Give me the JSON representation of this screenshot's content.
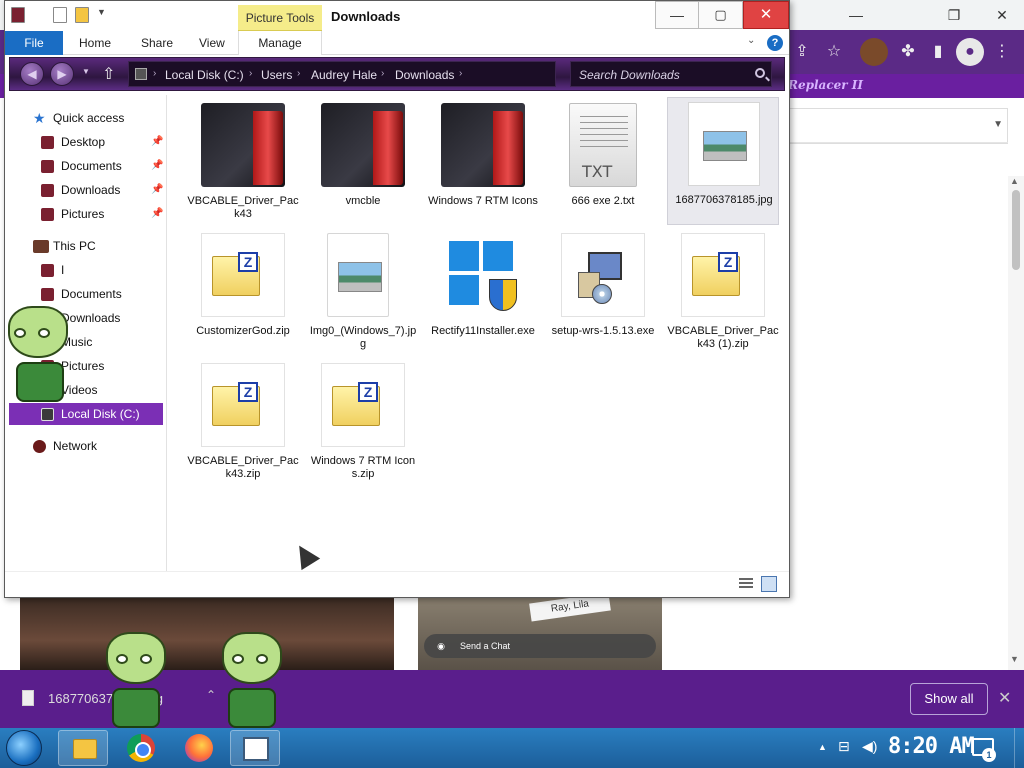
{
  "browser": {
    "extension_label": "Replacer II",
    "chat_placeholder": "Send a Chat",
    "photo_tag": "Ray, Lila"
  },
  "explorer": {
    "context_tab": "Picture Tools",
    "title": "Downloads",
    "ribbon_tabs": [
      "File",
      "Home",
      "Share",
      "View",
      "Manage"
    ],
    "breadcrumb": [
      "Local Disk (C:)",
      "Users",
      "Audrey Hale",
      "Downloads"
    ],
    "search_placeholder": "Search Downloads",
    "nav": {
      "quick_access": "Quick access",
      "desktop": "Desktop",
      "documents": "Documents",
      "downloads": "Downloads",
      "pictures": "Pictures",
      "this_pc": "This PC",
      "pc_item1": "I",
      "pc_documents": "Documents",
      "pc_downloads": "Downloads",
      "pc_music": "Music",
      "pc_pictures": "Pictures",
      "pc_videos": "Videos",
      "local_disk": "Local Disk (C:)",
      "network": "Network"
    },
    "files": [
      {
        "name": "VBCABLE_Driver_Pack43",
        "type": "folder"
      },
      {
        "name": "vmcble",
        "type": "folder"
      },
      {
        "name": "Windows 7 RTM Icons",
        "type": "folder"
      },
      {
        "name": "666 exe 2.txt",
        "type": "txt",
        "badge": "TXT"
      },
      {
        "name": "1687706378185.jpg",
        "type": "jpg",
        "selected": true
      },
      {
        "name": "CustomizerGod.zip",
        "type": "zip"
      },
      {
        "name": "Img0_(Windows_7).jpg",
        "type": "jpg"
      },
      {
        "name": "Rectify11Installer.exe",
        "type": "exe"
      },
      {
        "name": "setup-wrs-1.5.13.exe",
        "type": "setup"
      },
      {
        "name": "VBCABLE_Driver_Pack43 (1).zip",
        "type": "zip"
      },
      {
        "name": "VBCABLE_Driver_Pack43.zip",
        "type": "zip"
      },
      {
        "name": "Windows 7 RTM Icons.zip",
        "type": "zip"
      }
    ]
  },
  "shelf": {
    "file_name": "1687706378185.jpg",
    "show_all": "Show all"
  },
  "taskbar": {
    "clock": "8:20 AM",
    "notification_count": "1"
  },
  "colors": {
    "accent_purple": "#7b2fb5",
    "shelf_purple": "#5a1e8c",
    "file_tab_blue": "#1a6dc4",
    "close_red": "#e04343",
    "picture_tools_yellow": "#f5ec8a"
  }
}
